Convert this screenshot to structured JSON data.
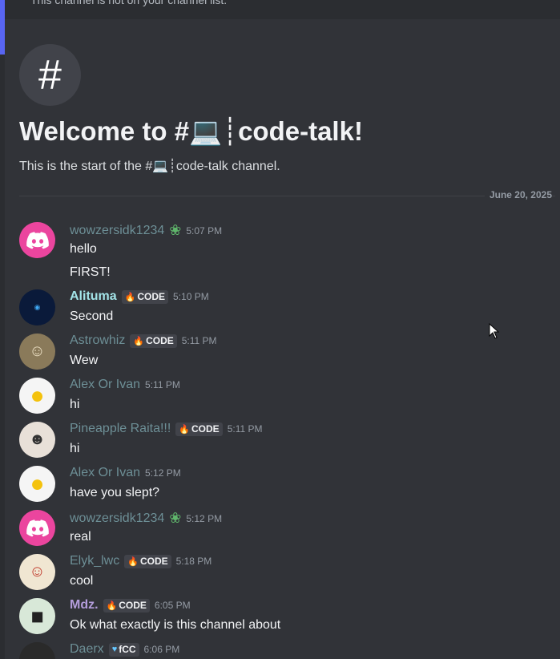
{
  "notice": "This channel is not on your channel list.",
  "welcome": {
    "icon": "#",
    "title": "Welcome to #💻┊code-talk!",
    "subtitle": "This is the start of the #💻┊code-talk channel."
  },
  "date_divider": "June 20, 2025",
  "messages": [
    {
      "user": "wowzersidk1234",
      "badge": "clover-icon",
      "time": "5:07 PM",
      "lines": [
        "hello",
        "FIRST!"
      ]
    },
    {
      "user": "Alituma",
      "tag": "CODE",
      "time": "5:10 PM",
      "lines": [
        "Second"
      ]
    },
    {
      "user": "Astrowhiz",
      "tag": "CODE",
      "time": "5:11 PM",
      "lines": [
        "Wew"
      ]
    },
    {
      "user": "Alex Or Ivan",
      "time": "5:11 PM",
      "lines": [
        "hi"
      ]
    },
    {
      "user": "Pineapple Raita!!!",
      "tag": "CODE",
      "time": "5:11 PM",
      "lines": [
        "hi"
      ]
    },
    {
      "user": "Alex Or Ivan",
      "time": "5:12 PM",
      "lines": [
        "have you slept?"
      ]
    },
    {
      "user": "wowzersidk1234",
      "badge": "clover-icon",
      "time": "5:12 PM",
      "lines": [
        "real"
      ]
    },
    {
      "user": "Elyk_lwc",
      "tag": "CODE",
      "time": "5:18 PM",
      "lines": [
        "cool"
      ]
    },
    {
      "user": "Mdz.",
      "tag": "CODE",
      "time": "6:05 PM",
      "lines": [
        "Ok what exactly is this channel about"
      ]
    },
    {
      "user": "Daerx",
      "tag": "fCC",
      "time": "6:06 PM",
      "lines": []
    }
  ],
  "colors": {
    "background": "#313338",
    "username_default": "#6d8f96",
    "username_alituma": "#a3e4e8",
    "username_mdz": "#b39ddb",
    "tag_background": "#41434a",
    "discord_avatar": "#eb459e"
  }
}
